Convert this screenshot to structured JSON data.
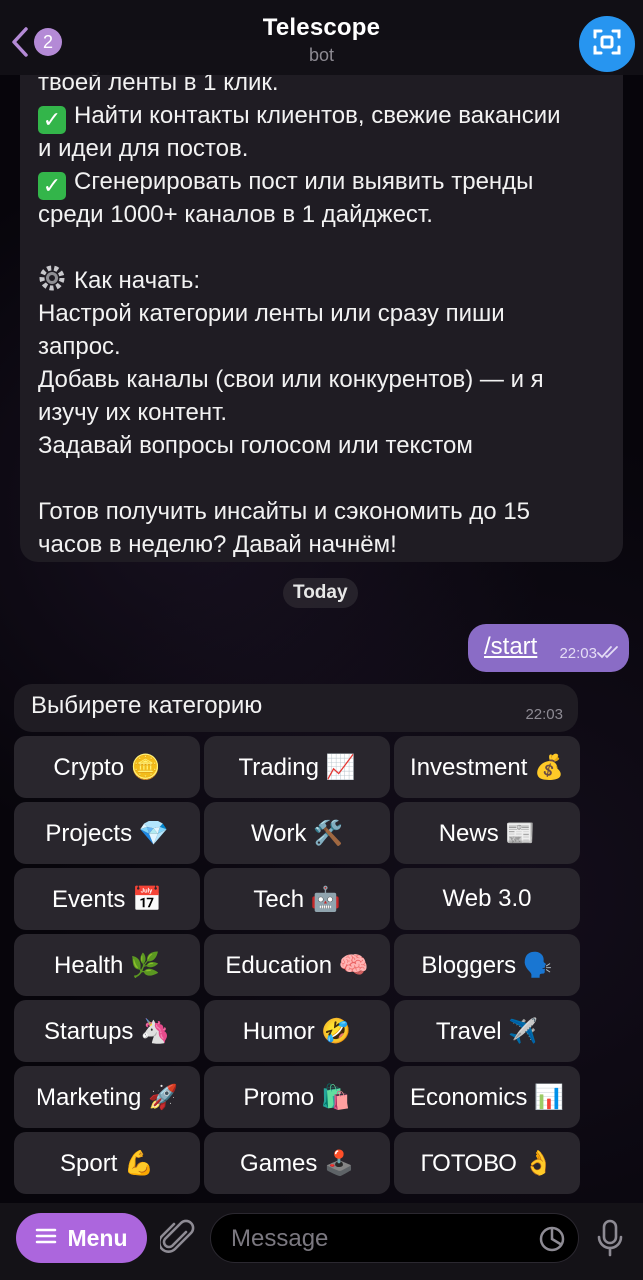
{
  "header": {
    "title": "Telescope",
    "subtitle": "bot",
    "back_badge": "2"
  },
  "bot_message": {
    "lines": [
      "твоей ленты в 1 клик.",
      "Найти контакты клиентов, свежие вакансии",
      "и идеи для постов.",
      "Сгенерировать пост или выявить тренды",
      "среди 1000+ каналов в 1 дайджест.",
      "",
      "Как начать:",
      "Настрой категории ленты или сразу пиши",
      "запрос.",
      "Добавь каналы (свои или конкурентов) — и я",
      "изучу их контент.",
      "Задавай вопросы голосом или текстом",
      "",
      "Готов получить инсайты и сэкономить до 15",
      "часов в неделю? Давай начнём!"
    ]
  },
  "date_chip": "Today",
  "outgoing": {
    "text": "/start",
    "time": "22:03"
  },
  "incoming": {
    "text": "Выбирете категорию",
    "time": "22:03"
  },
  "keyboard": [
    "Crypto 🪙",
    "Trading 📈",
    "Investment 💰",
    "Projects 💎",
    "Work 🛠️",
    "News 📰",
    "Events 📅",
    "Tech 🤖",
    "Web 3.0",
    "Health 🌿",
    "Education 🧠",
    "Bloggers 🗣️",
    "Startups 🦄",
    "Humor 🤣",
    "Travel ✈️",
    "Marketing 🚀",
    "Promo 🛍️",
    "Economics 📊",
    "Sport 💪",
    "Games 🕹️",
    "ГОТОВО 👌"
  ],
  "bottom_bar": {
    "menu_label": "Menu",
    "message_placeholder": "Message"
  },
  "colors": {
    "accent_purple": "#ac66dd",
    "outgoing_bubble": "#8a6cc6",
    "avatar_blue": "#2795f0",
    "incoming_bubble": "#1f1c23",
    "keyboard_button": "#29262d"
  },
  "icons": [
    "back-arrow-icon",
    "scan-icon",
    "check-icon",
    "gear-icon",
    "double-check-icon",
    "menu-icon",
    "paperclip-icon",
    "sticker-icon",
    "microphone-icon"
  ]
}
